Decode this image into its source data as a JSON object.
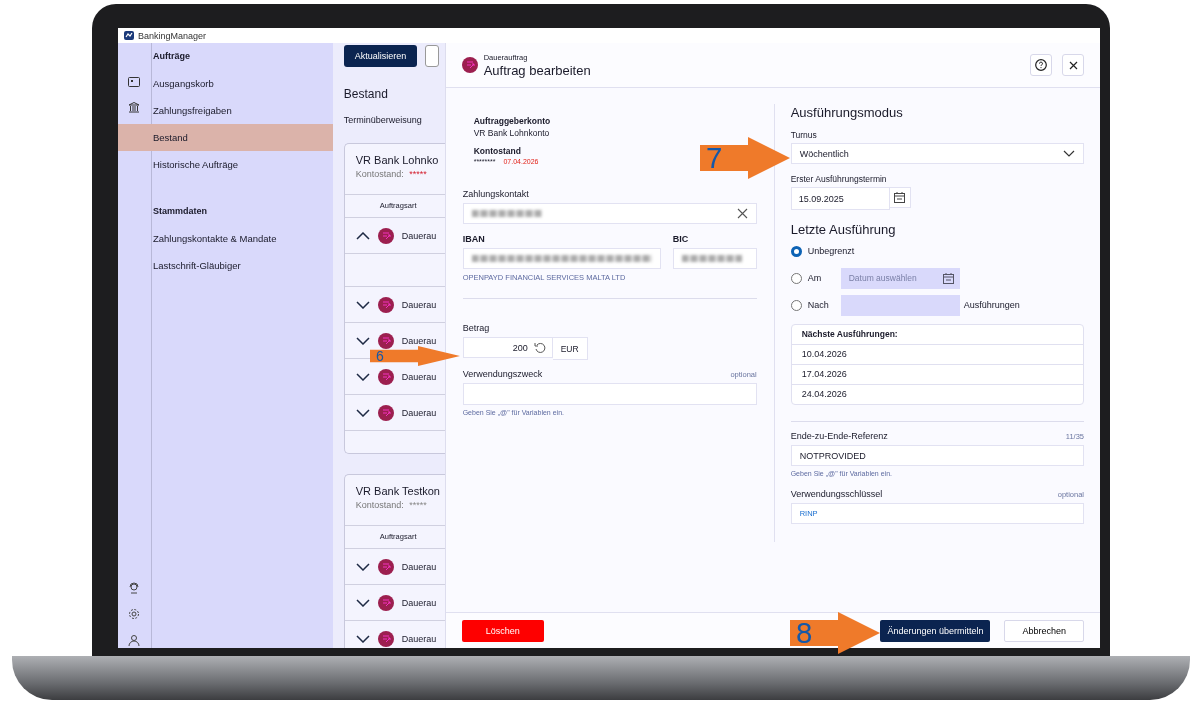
{
  "app": {
    "title": "BankingManager"
  },
  "nav": {
    "sections": [
      {
        "heading": "Aufträge",
        "items": [
          {
            "label": "Ausgangskorb",
            "selected": false
          },
          {
            "label": "Zahlungsfreigaben",
            "selected": false
          },
          {
            "label": "Bestand",
            "selected": true
          },
          {
            "label": "Historische Aufträge",
            "selected": false
          }
        ]
      },
      {
        "heading": "Stammdaten",
        "items": [
          {
            "label": "Zahlungskontakte & Mandate",
            "selected": false
          },
          {
            "label": "Lastschrift-Gläubiger",
            "selected": false
          }
        ]
      }
    ]
  },
  "main": {
    "refresh_button": "Aktualisieren",
    "heading": "Bestand",
    "subheading": "Terminüberweisung",
    "accounts": [
      {
        "name": "VR Bank Lohnko",
        "balance_label": "Kontostand:",
        "balance": "*****",
        "negative": true,
        "column": "Auftragsart",
        "rows": [
          {
            "type": "Dauerau",
            "expanded": true
          },
          {
            "type": "Dauerau",
            "expanded": false
          },
          {
            "type": "Dauerau",
            "expanded": false
          },
          {
            "type": "Dauerau",
            "expanded": false
          },
          {
            "type": "Dauerau",
            "expanded": false
          }
        ]
      },
      {
        "name": "VR Bank Testkon",
        "balance_label": "Kontostand:",
        "balance": "*****",
        "negative": false,
        "column": "Auftragsart",
        "rows": [
          {
            "type": "Dauerau",
            "expanded": false
          },
          {
            "type": "Dauerau",
            "expanded": false
          },
          {
            "type": "Dauerau",
            "expanded": false
          }
        ]
      }
    ]
  },
  "dialog": {
    "kind_label": "Dauerauftrag",
    "title": "Auftrag bearbeiten",
    "account_label": "Auftraggeberkonto",
    "account": "VR Bank Lohnkonto",
    "balance_label": "Kontostand",
    "balance": "********",
    "balance_date": "07.04.2026",
    "contact_label": "Zahlungskontakt",
    "iban_label": "IBAN",
    "bic_label": "BIC",
    "bank_name": "OPENPAYD FINANCIAL SERVICES MALTA LTD",
    "amount_label": "Betrag",
    "amount": "200",
    "currency": "EUR",
    "purpose_label": "Verwendungszweck",
    "purpose_optional": "optional",
    "purpose_hint": "Geben Sie „@\" für Variablen ein.",
    "mode_heading": "Ausführungsmodus",
    "interval_label": "Turnus",
    "interval": "Wöchentlich",
    "first_date_label": "Erster Ausführungstermin",
    "first_date": "15.09.2025",
    "last_heading": "Letzte Ausführung",
    "end_options": [
      {
        "label": "Unbegrenzt",
        "kind": "plain",
        "selected": true
      },
      {
        "label": "Am",
        "kind": "date",
        "placeholder": "Datum auswählen",
        "selected": false
      },
      {
        "label": "Nach",
        "kind": "count",
        "suffix": "Ausführungen",
        "selected": false
      }
    ],
    "next_heading": "Nächste Ausführungen:",
    "next_dates": [
      "10.04.2026",
      "17.04.2026",
      "24.04.2026"
    ],
    "e2e_label": "Ende-zu-Ende-Referenz",
    "e2e_counter": "11/35",
    "e2e_value": "NOTPROVIDED",
    "e2e_hint": "Geben Sie „@\" für Variablen ein.",
    "key_label": "Verwendungsschlüssel",
    "key_optional": "optional",
    "key_value": "RINP",
    "delete_button": "Löschen",
    "submit_button": "Änderungen übermitteln",
    "cancel_button": "Abbrechen"
  },
  "callouts": [
    {
      "number": "6"
    },
    {
      "number": "7"
    },
    {
      "number": "8"
    }
  ]
}
